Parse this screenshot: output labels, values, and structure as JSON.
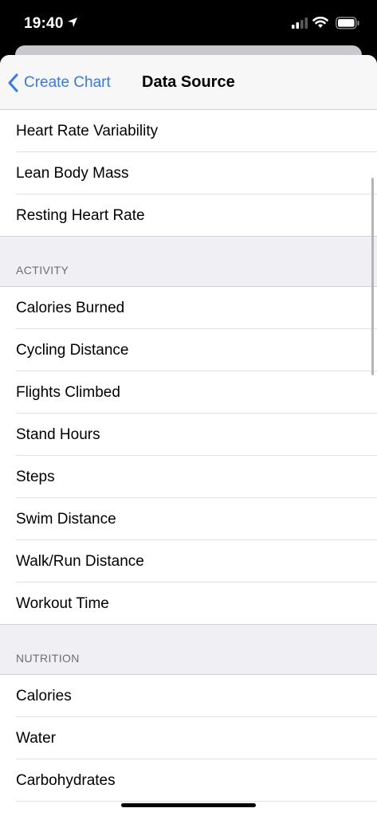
{
  "status_bar": {
    "time": "19:40",
    "icons": [
      "location-arrow-icon",
      "cellular-signal-icon",
      "wifi-icon",
      "battery-icon"
    ]
  },
  "nav": {
    "back_label": "Create Chart",
    "title": "Data Source",
    "accent_color": "#3478f6"
  },
  "lists": {
    "top": [
      {
        "label": "Heart Rate Variability"
      },
      {
        "label": "Lean Body Mass"
      },
      {
        "label": "Resting Heart Rate"
      }
    ],
    "activity": {
      "header": "ACTIVITY",
      "items": [
        {
          "label": "Calories Burned"
        },
        {
          "label": "Cycling Distance"
        },
        {
          "label": "Flights Climbed"
        },
        {
          "label": "Stand Hours"
        },
        {
          "label": "Steps"
        },
        {
          "label": "Swim Distance"
        },
        {
          "label": "Walk/Run Distance"
        },
        {
          "label": "Workout Time"
        }
      ]
    },
    "nutrition": {
      "header": "NUTRITION",
      "items": [
        {
          "label": "Calories"
        },
        {
          "label": "Water"
        },
        {
          "label": "Carbohydrates"
        }
      ]
    }
  }
}
